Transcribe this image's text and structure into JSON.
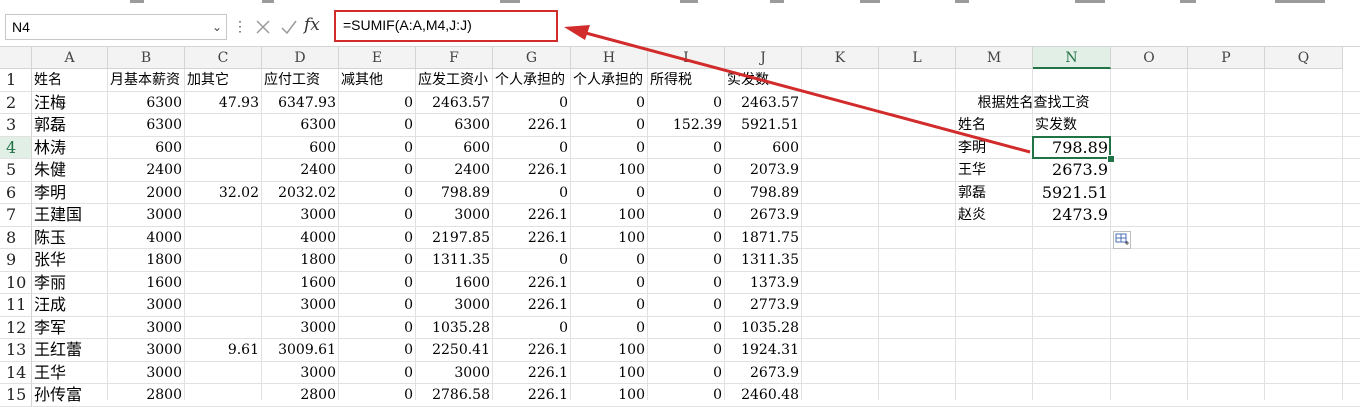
{
  "namebox": {
    "value": "N4"
  },
  "formula_bar": {
    "fx_label": "fx",
    "formula": "=SUMIF(A:A,M4,J:J)"
  },
  "columns": [
    "A",
    "B",
    "C",
    "D",
    "E",
    "F",
    "G",
    "H",
    "I",
    "J",
    "K",
    "L",
    "M",
    "N",
    "O",
    "P",
    "Q"
  ],
  "selected_column": "N",
  "rows": [
    "1",
    "2",
    "3",
    "4",
    "5",
    "6",
    "7",
    "8",
    "9",
    "10",
    "11",
    "12",
    "13",
    "14",
    "15"
  ],
  "selected_row": "4",
  "sheet": {
    "headers": [
      "姓名",
      "月基本薪资",
      "加其它",
      "应付工资",
      "减其他",
      "应发工资小",
      "个人承担的",
      "个人承担的",
      "所得税",
      "实发数"
    ],
    "records": [
      [
        "汪梅",
        "6300",
        "47.93",
        "6347.93",
        "0",
        "2463.57",
        "0",
        "0",
        "0",
        "2463.57"
      ],
      [
        "郭磊",
        "6300",
        "",
        "6300",
        "0",
        "6300",
        "226.1",
        "0",
        "152.39",
        "5921.51"
      ],
      [
        "林涛",
        "600",
        "",
        "600",
        "0",
        "600",
        "0",
        "0",
        "0",
        "600"
      ],
      [
        "朱健",
        "2400",
        "",
        "2400",
        "0",
        "2400",
        "226.1",
        "100",
        "0",
        "2073.9"
      ],
      [
        "李明",
        "2000",
        "32.02",
        "2032.02",
        "0",
        "798.89",
        "0",
        "0",
        "0",
        "798.89"
      ],
      [
        "王建国",
        "3000",
        "",
        "3000",
        "0",
        "3000",
        "226.1",
        "100",
        "0",
        "2673.9"
      ],
      [
        "陈玉",
        "4000",
        "",
        "4000",
        "0",
        "2197.85",
        "226.1",
        "100",
        "0",
        "1871.75"
      ],
      [
        "张华",
        "1800",
        "",
        "1800",
        "0",
        "1311.35",
        "0",
        "0",
        "0",
        "1311.35"
      ],
      [
        "李丽",
        "1600",
        "",
        "1600",
        "0",
        "1600",
        "226.1",
        "0",
        "0",
        "1373.9"
      ],
      [
        "汪成",
        "3000",
        "",
        "3000",
        "0",
        "3000",
        "226.1",
        "0",
        "0",
        "2773.9"
      ],
      [
        "李军",
        "3000",
        "",
        "3000",
        "0",
        "1035.28",
        "0",
        "0",
        "0",
        "1035.28"
      ],
      [
        "王红蕾",
        "3000",
        "9.61",
        "3009.61",
        "0",
        "2250.41",
        "226.1",
        "100",
        "0",
        "1924.31"
      ],
      [
        "王华",
        "3000",
        "",
        "3000",
        "0",
        "3000",
        "226.1",
        "100",
        "0",
        "2673.9"
      ],
      [
        "孙传富",
        "2800",
        "",
        "2800",
        "0",
        "2786.58",
        "226.1",
        "100",
        "0",
        "2460.48"
      ]
    ]
  },
  "lookup": {
    "title": "根据姓名查找工资",
    "header_name": "姓名",
    "header_pay": "实发数",
    "rows": [
      {
        "name": "李明",
        "pay": "798.89"
      },
      {
        "name": "王华",
        "pay": "2673.9"
      },
      {
        "name": "郭磊",
        "pay": "5921.51"
      },
      {
        "name": "赵炎",
        "pay": "2473.9"
      }
    ]
  },
  "colors": {
    "accent_green": "#217346",
    "highlight_red": "#d22b2b"
  },
  "icons": {
    "cancel": "cancel-x-icon",
    "confirm": "confirm-check-icon",
    "function": "fx-icon",
    "quick_analysis": "quick-analysis-icon"
  }
}
